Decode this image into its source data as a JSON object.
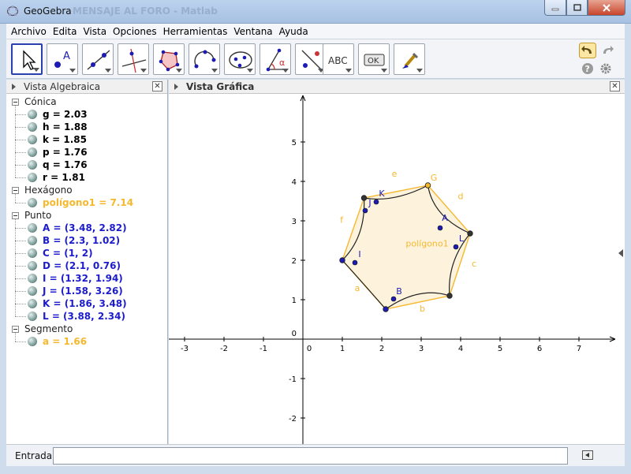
{
  "window": {
    "title": "GeoGebra",
    "ghost_title": "MENSAJE AL FORO - Matlab"
  },
  "menu": [
    "Archivo",
    "Edita",
    "Vista",
    "Opciones",
    "Herramientas",
    "Ventana",
    "Ayuda"
  ],
  "toolbar": {
    "tools": [
      "move-tool",
      "point-tool",
      "line-tool",
      "perpendicular-tool",
      "polygon-tool",
      "circle-tool",
      "conic-tool",
      "angle-tool",
      "reflect-tool",
      "text-tool",
      "button-tool",
      "move-graphics-tool"
    ],
    "text_tool_label": "ABC",
    "button_tool_label": "OK"
  },
  "algebra": {
    "title": "Vista Algebraica",
    "groups": [
      {
        "label": "Cónica",
        "items": [
          {
            "text": "g = 2.03",
            "color": "#000000"
          },
          {
            "text": "h = 1.88",
            "color": "#000000"
          },
          {
            "text": "k = 1.85",
            "color": "#000000"
          },
          {
            "text": "p = 1.76",
            "color": "#000000"
          },
          {
            "text": "q = 1.76",
            "color": "#000000"
          },
          {
            "text": "r = 1.81",
            "color": "#000000"
          }
        ]
      },
      {
        "label": "Hexágono",
        "items": [
          {
            "text": "polígono1 = 7.14",
            "color": "#f5b82e"
          }
        ]
      },
      {
        "label": "Punto",
        "items": [
          {
            "text": "A = (3.48, 2.82)",
            "color": "#1c1ccc"
          },
          {
            "text": "B = (2.3, 1.02)",
            "color": "#1c1ccc"
          },
          {
            "text": "C = (1, 2)",
            "color": "#1c1ccc"
          },
          {
            "text": "D = (2.1, 0.76)",
            "color": "#1c1ccc"
          },
          {
            "text": "I = (1.32, 1.94)",
            "color": "#1c1ccc"
          },
          {
            "text": "J = (1.58, 3.26)",
            "color": "#1c1ccc"
          },
          {
            "text": "K = (1.86, 3.48)",
            "color": "#1c1ccc"
          },
          {
            "text": "L = (3.88, 2.34)",
            "color": "#1c1ccc"
          }
        ]
      },
      {
        "label": "Segmento",
        "items": [
          {
            "text": "a = 1.66",
            "color": "#f5b82e"
          }
        ]
      }
    ]
  },
  "graphics": {
    "title": "Vista Gráfica",
    "x_ticks": [
      "-3",
      "-2",
      "-1",
      "0",
      "1",
      "2",
      "3",
      "4",
      "5",
      "6",
      "7"
    ],
    "y_ticks": [
      "5",
      "4",
      "3",
      "2",
      "1",
      "0",
      "-1",
      "-2"
    ],
    "polygon_label": "polígono1",
    "segment_labels": [
      "a",
      "b",
      "c",
      "d",
      "e",
      "f"
    ],
    "point_labels": [
      "A",
      "B",
      "G",
      "I",
      "J",
      "K",
      "L"
    ],
    "colors": {
      "polygon_stroke": "#f5b82e",
      "polygon_fill": "#fdf3dd",
      "point": "#1c1cb4",
      "dark_point": "#333333",
      "arc": "#222222"
    }
  },
  "input": {
    "label": "Entrada:",
    "value": ""
  }
}
